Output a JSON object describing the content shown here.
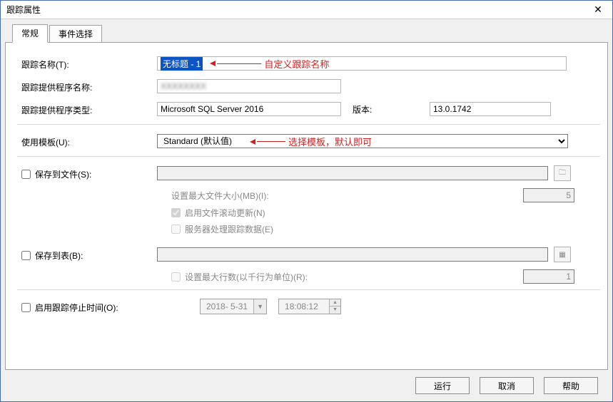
{
  "window": {
    "title": "跟踪属性"
  },
  "tabs": {
    "general": "常规",
    "events": "事件选择"
  },
  "labels": {
    "trace_name": "跟踪名称(T):",
    "provider_name": "跟踪提供程序名称:",
    "provider_type": "跟踪提供程序类型:",
    "version": "版本:",
    "use_template": "使用模板(U):",
    "save_to_file": "保存到文件(S):",
    "max_file_size": "设置最大文件大小(MB)(I):",
    "file_rollover": "启用文件滚动更新(N)",
    "server_process": "服务器处理跟踪数据(E)",
    "save_to_table": "保存到表(B):",
    "max_rows": "设置最大行数(以千行为单位)(R):",
    "stop_time": "启用跟踪停止时间(O):"
  },
  "values": {
    "trace_name": "无标题 - 1",
    "provider_name": "",
    "provider_type": "Microsoft SQL Server 2016",
    "version": "13.0.1742",
    "template": "Standard (默认值)",
    "max_file_size": "5",
    "max_rows": "1",
    "stop_date": "2018- 5-31",
    "stop_time": "18:08:12"
  },
  "annotations": {
    "name_note": "自定义跟踪名称",
    "template_note": "选择模板，默认即可"
  },
  "buttons": {
    "run": "运行",
    "cancel": "取消",
    "help": "帮助"
  }
}
